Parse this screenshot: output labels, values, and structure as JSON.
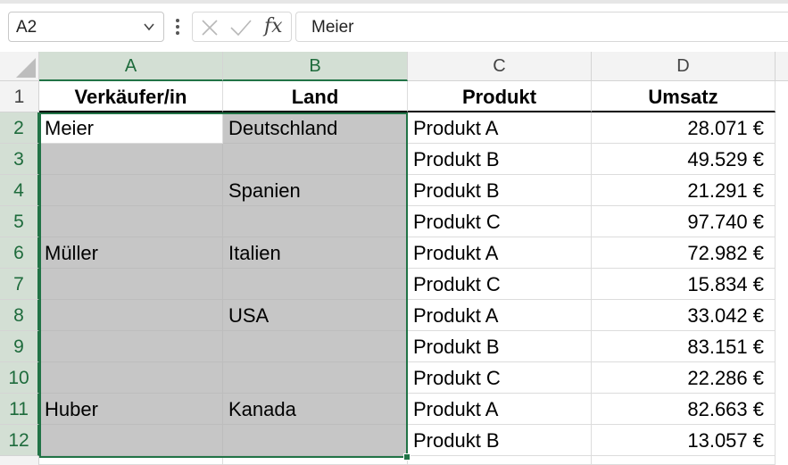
{
  "formula_bar": {
    "name_box": "A2",
    "fx_label": "fx",
    "formula_value": "Meier"
  },
  "columns": [
    "A",
    "B",
    "C",
    "D"
  ],
  "rows": [
    "1",
    "2",
    "3",
    "4",
    "5",
    "6",
    "7",
    "8",
    "9",
    "10",
    "11",
    "12"
  ],
  "table": {
    "headers": [
      "Verkäufer/in",
      "Land",
      "Produkt",
      "Umsatz"
    ],
    "data": [
      [
        "Meier",
        "Deutschland",
        "Produkt A",
        "28.071 €"
      ],
      [
        "",
        "",
        "Produkt B",
        "49.529 €"
      ],
      [
        "",
        "Spanien",
        "Produkt B",
        "21.291 €"
      ],
      [
        "",
        "",
        "Produkt C",
        "97.740 €"
      ],
      [
        "Müller",
        "Italien",
        "Produkt A",
        "72.982 €"
      ],
      [
        "",
        "",
        "Produkt C",
        "15.834 €"
      ],
      [
        "",
        "USA",
        "Produkt A",
        "33.042 €"
      ],
      [
        "",
        "",
        "Produkt B",
        "83.151 €"
      ],
      [
        "",
        "",
        "Produkt C",
        "22.286 €"
      ],
      [
        "Huber",
        "Kanada",
        "Produkt A",
        "82.663 €"
      ],
      [
        "",
        "",
        "Produkt B",
        "13.057 €"
      ]
    ]
  },
  "colors": {
    "selection_accent": "#217346",
    "selected_fill": "#c6c6c6",
    "header_selected": "#d3dfd4"
  }
}
